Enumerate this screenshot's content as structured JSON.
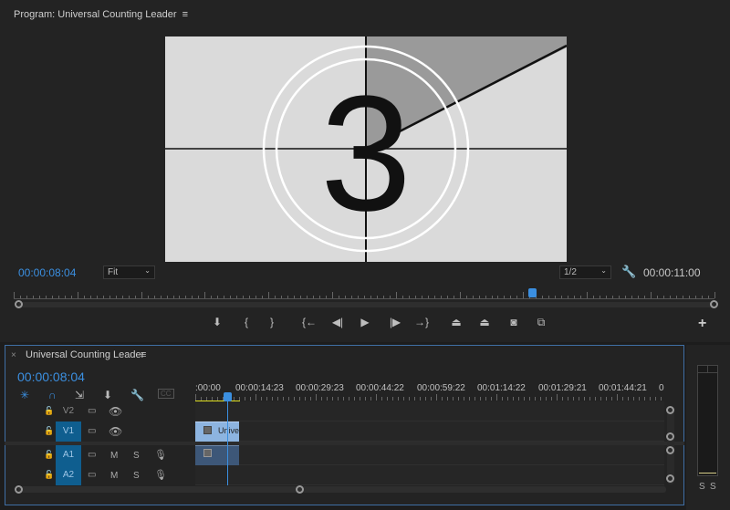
{
  "program": {
    "title": "Program: Universal Counting Leader",
    "menu_icon": "hamburger-icon",
    "timecode": "00:00:08:04",
    "zoom": "Fit",
    "resolution": "1/2",
    "duration": "00:00:11:00",
    "playhead_fraction": 0.74,
    "frame": {
      "number": "3"
    },
    "controls": [
      "add-marker",
      "mark-in",
      "mark-out",
      "go-to-in",
      "step-back",
      "play",
      "step-forward",
      "go-to-out",
      "lift",
      "extract",
      "export-frame",
      "compare"
    ],
    "control_glyphs": [
      "⬇",
      "{",
      "}",
      "{←",
      "◀|",
      "▶",
      "|▶",
      "→}",
      "⏏",
      "⏏",
      "◙",
      "⧉"
    ],
    "add_glyph": "+"
  },
  "timeline": {
    "title": "Universal Counting Leader",
    "close": "×",
    "timecode": "00:00:08:04",
    "ruler": [
      ":00:00",
      "00:00:14:23",
      "00:00:29:23",
      "00:00:44:22",
      "00:00:59:22",
      "00:01:14:22",
      "00:01:29:21",
      "00:01:44:21",
      "0"
    ],
    "tracks": [
      {
        "name": "V2",
        "type": "video"
      },
      {
        "name": "V1",
        "type": "video"
      },
      {
        "name": "A1",
        "type": "audio",
        "m": "M",
        "s": "S"
      },
      {
        "name": "A2",
        "type": "audio",
        "m": "M",
        "s": "S"
      }
    ],
    "clip_label": "Unive",
    "tools_glyphs": [
      "✳",
      "∩",
      "⇲",
      "⬇",
      "🔧",
      "CC"
    ]
  },
  "meter": {
    "solo": [
      "S",
      "S"
    ]
  },
  "colors": {
    "accent": "#3b8fe0",
    "target": "#0f5e8f",
    "clip_video": "#8db4e0",
    "clip_audio": "#3d5778"
  }
}
